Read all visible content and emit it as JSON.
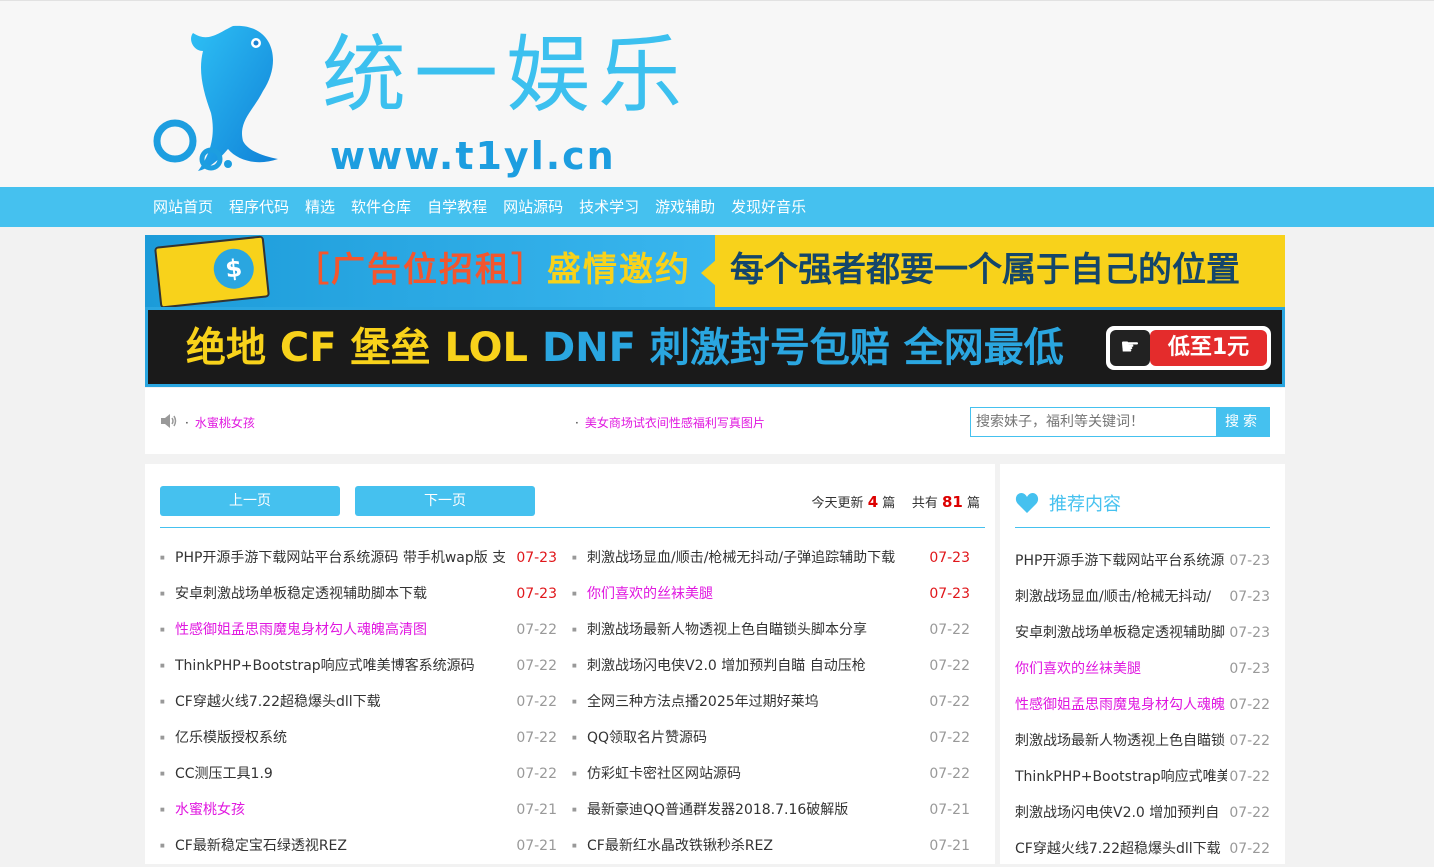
{
  "header": {
    "logo_text": "统一娱乐",
    "logo_url": "www.t1yl.cn"
  },
  "nav": {
    "items": [
      "网站首页",
      "程序代码",
      "精选",
      "软件仓库",
      "自学教程",
      "网站源码",
      "技术学习",
      "游戏辅助",
      "发现好音乐"
    ]
  },
  "banner1": {
    "left_text_a": "［广告位招租］",
    "left_text_b": "盛情邀约",
    "right_text": "每个强者都要一个属于自己的位置",
    "coin": "$"
  },
  "banner2": {
    "text_yellow": "绝地  CF 堡垒  LOL ",
    "text_blue": "DNF 刺激封号包赔  全网最低",
    "btn_text": "低至1元",
    "btn_icon": "☛"
  },
  "notice": {
    "items": [
      "水蜜桃女孩",
      "美女商场试衣间性感福利写真图片"
    ],
    "search_placeholder": "搜索妹子，福利等关键词！",
    "search_button": "搜索"
  },
  "main": {
    "prev_label": "上一页",
    "next_label": "下一页",
    "stats_today_label": "今天更新",
    "stats_today_count": "4",
    "stats_unit": "篇",
    "stats_total_label": "共有",
    "stats_total_count": "81",
    "left_list": [
      {
        "title": "PHP开源手游下载网站平台系统源码 带手机wap版 支",
        "date": "07-23",
        "pink": false,
        "red": true
      },
      {
        "title": "安卓刺激战场单板稳定透视辅助脚本下载",
        "date": "07-23",
        "pink": false,
        "red": true
      },
      {
        "title": "性感御姐孟思雨魔鬼身材勾人魂魄高清图",
        "date": "07-22",
        "pink": true,
        "red": false
      },
      {
        "title": "ThinkPHP+Bootstrap响应式唯美博客系统源码",
        "date": "07-22",
        "pink": false,
        "red": false
      },
      {
        "title": "CF穿越火线7.22超稳爆头dll下载",
        "date": "07-22",
        "pink": false,
        "red": false
      },
      {
        "title": "亿乐模版授权系统",
        "date": "07-22",
        "pink": false,
        "red": false
      },
      {
        "title": "CC测压工具1.9",
        "date": "07-22",
        "pink": false,
        "red": false
      },
      {
        "title": "水蜜桃女孩",
        "date": "07-21",
        "pink": true,
        "red": false
      },
      {
        "title": "CF最新稳定宝石绿透视REZ",
        "date": "07-21",
        "pink": false,
        "red": false
      }
    ],
    "right_list": [
      {
        "title": "刺激战场显血/顺击/枪械无抖动/子弹追踪辅助下载",
        "date": "07-23",
        "pink": false,
        "red": true
      },
      {
        "title": "你们喜欢的丝袜美腿",
        "date": "07-23",
        "pink": true,
        "red": true
      },
      {
        "title": "刺激战场最新人物透视上色自瞄锁头脚本分享",
        "date": "07-22",
        "pink": false,
        "red": false
      },
      {
        "title": "刺激战场闪电侠V2.0 增加预判自瞄 自动压枪",
        "date": "07-22",
        "pink": false,
        "red": false
      },
      {
        "title": "全网三种方法点播2025年过期好莱坞",
        "date": "07-22",
        "pink": false,
        "red": false
      },
      {
        "title": "QQ领取名片赞源码",
        "date": "07-22",
        "pink": false,
        "red": false
      },
      {
        "title": "仿彩虹卡密社区网站源码",
        "date": "07-22",
        "pink": false,
        "red": false
      },
      {
        "title": "最新豪迪QQ普通群发器2018.7.16破解版",
        "date": "07-21",
        "pink": false,
        "red": false
      },
      {
        "title": "CF最新红水晶改铁锹秒杀REZ",
        "date": "07-21",
        "pink": false,
        "red": false
      }
    ]
  },
  "sidebar": {
    "title": "推荐内容",
    "items": [
      {
        "title": "PHP开源手游下载网站平台系统源",
        "date": "07-23",
        "pink": false
      },
      {
        "title": "刺激战场显血/顺击/枪械无抖动/",
        "date": "07-23",
        "pink": false
      },
      {
        "title": "安卓刺激战场单板稳定透视辅助脚",
        "date": "07-23",
        "pink": false
      },
      {
        "title": "你们喜欢的丝袜美腿",
        "date": "07-23",
        "pink": true
      },
      {
        "title": "性感御姐孟思雨魔鬼身材勾人魂魄",
        "date": "07-22",
        "pink": true
      },
      {
        "title": "刺激战场最新人物透视上色自瞄锁",
        "date": "07-22",
        "pink": false
      },
      {
        "title": "ThinkPHP+Bootstrap响应式唯美",
        "date": "07-22",
        "pink": false
      },
      {
        "title": "刺激战场闪电侠V2.0 增加预判自",
        "date": "07-22",
        "pink": false
      },
      {
        "title": "CF穿越火线7.22超稳爆头dll下载",
        "date": "07-22",
        "pink": false
      }
    ]
  },
  "colors": {
    "accent": "#45c1ef",
    "pink": "#e018e0",
    "red": "#e0171b"
  }
}
